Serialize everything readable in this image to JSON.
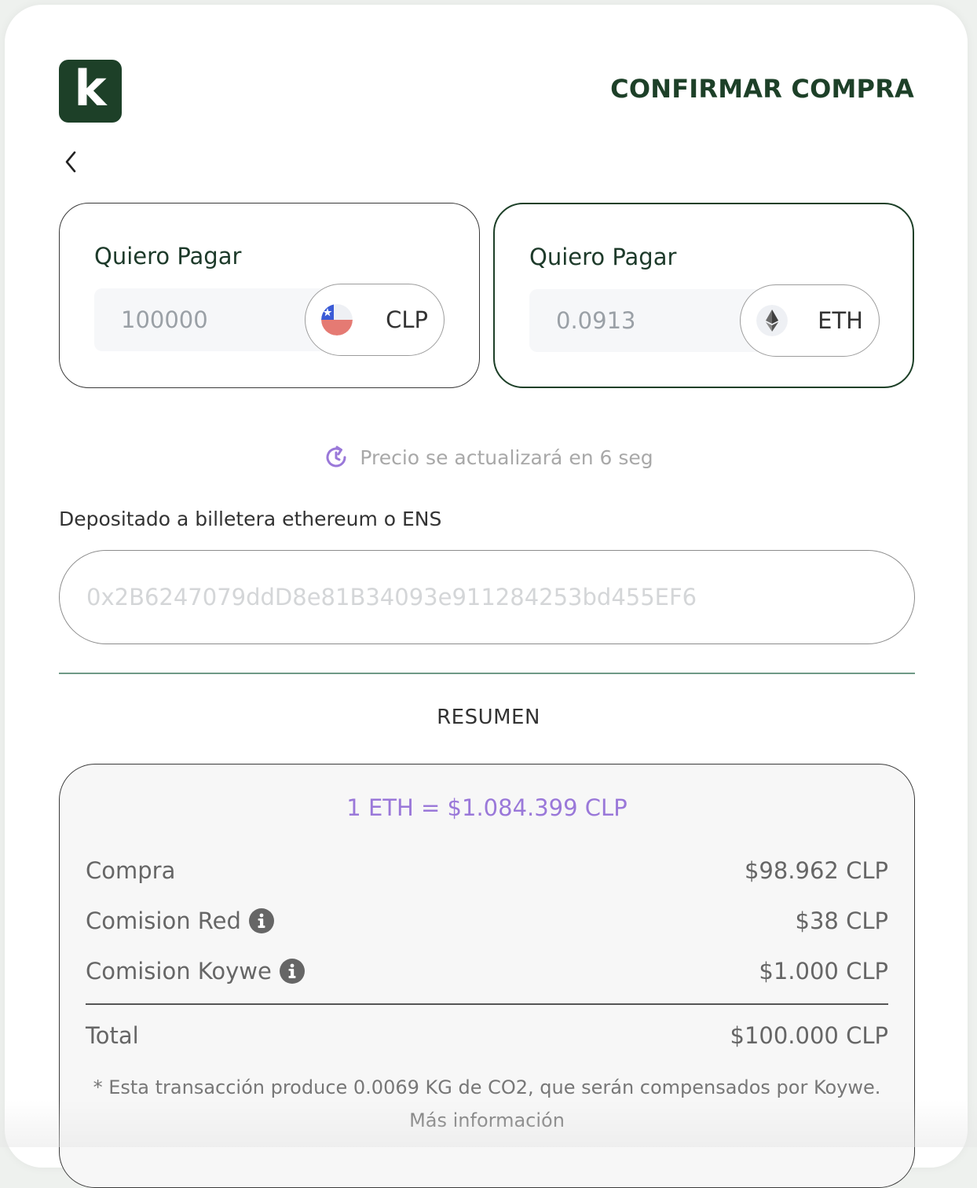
{
  "header": {
    "logo_letter": "k",
    "title": "CONFIRMAR COMPRA",
    "back_icon": "chevron-left-icon"
  },
  "pay_from": {
    "label": "Quiero Pagar",
    "amount": "100000",
    "currency": "CLP",
    "currency_icon": "chile-flag-icon"
  },
  "pay_to": {
    "label": "Quiero Pagar",
    "amount": "0.0913",
    "currency": "ETH",
    "currency_icon": "ethereum-icon"
  },
  "timer": {
    "icon": "refresh-clock-icon",
    "text": "Precio se actualizará en 6 seg"
  },
  "wallet": {
    "label": "Depositado a billetera ethereum o ENS",
    "placeholder": "0x2B6247079ddD8e81B34093e911284253bd455EF6"
  },
  "summary": {
    "title": "RESUMEN",
    "rate": "1 ETH = $1.084.399 CLP",
    "rows": [
      {
        "label": "Compra",
        "value": "$98.962 CLP"
      },
      {
        "label": "Comision Red",
        "value": "$38 CLP"
      },
      {
        "label": "Comision Koywe",
        "value": "$1.000 CLP"
      }
    ],
    "total_label": "Total",
    "total_value": "$100.000 CLP",
    "note": "* Esta transacción produce 0.0069 KG de CO2, que serán compensados por Koywe.",
    "note_link": "Más información"
  },
  "colors": {
    "brand": "#1d4028",
    "accent": "#9a78d9",
    "divider": "#6f9a86"
  }
}
